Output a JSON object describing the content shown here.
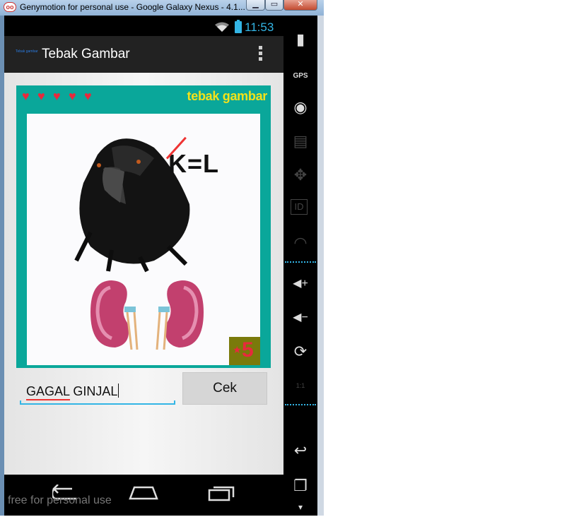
{
  "window": {
    "title": "Genymotion for personal use - Google Galaxy Nexus - 4.1...",
    "logo": "oo",
    "minimize_glyph": "▁",
    "maximize_glyph": "▭",
    "close_glyph": "✕"
  },
  "status_bar": {
    "time": "11:53",
    "icons": [
      "wifi-icon",
      "battery-charging-icon"
    ]
  },
  "action_bar": {
    "app_icon_text": "Tebak gambar",
    "title": "Tebak Gambar",
    "menu_icon": "overflow-menu-icon"
  },
  "puzzle": {
    "lives": 5,
    "heart_glyph": "♥",
    "brand": "tebak gambar",
    "clue_formula": "K=L",
    "score_star": "★",
    "score": "5",
    "images": [
      "crow",
      "kidneys"
    ]
  },
  "answer": {
    "value": "GAGAL GINJAL",
    "misspelled_word": "GAGAL"
  },
  "check_button": {
    "label": "Cek"
  },
  "navigation": {
    "icons": [
      "back-icon",
      "home-icon",
      "recent-apps-icon"
    ]
  },
  "watermark": "free for personal use",
  "side_panel": {
    "items": [
      {
        "icon": "battery-icon",
        "glyph": "▮"
      },
      {
        "icon": "gps-icon",
        "glyph": "GPS"
      },
      {
        "icon": "camera-icon",
        "glyph": "◉"
      },
      {
        "icon": "clapperboard-icon",
        "glyph": "▤"
      },
      {
        "icon": "dpad-icon",
        "glyph": "✥"
      },
      {
        "icon": "id-icon",
        "glyph": "ID"
      },
      {
        "icon": "rss-icon",
        "glyph": "◠"
      },
      {
        "icon": "volume-up-icon",
        "glyph": "◀+"
      },
      {
        "icon": "volume-down-icon",
        "glyph": "◀−"
      },
      {
        "icon": "rotate-icon",
        "glyph": "⟳"
      },
      {
        "icon": "scale-icon",
        "glyph": "1:1"
      },
      {
        "icon": "back-icon",
        "glyph": "↩"
      },
      {
        "icon": "recent-apps-icon",
        "glyph": "❐"
      },
      {
        "icon": "menu-icon",
        "glyph": "▾"
      }
    ]
  },
  "colors": {
    "accent": "#33b5e5",
    "puzzle_frame": "#0aa79a",
    "brand_text": "#f3e21a",
    "hearts": "#e8293c",
    "score_box": "#7a7a0b"
  }
}
